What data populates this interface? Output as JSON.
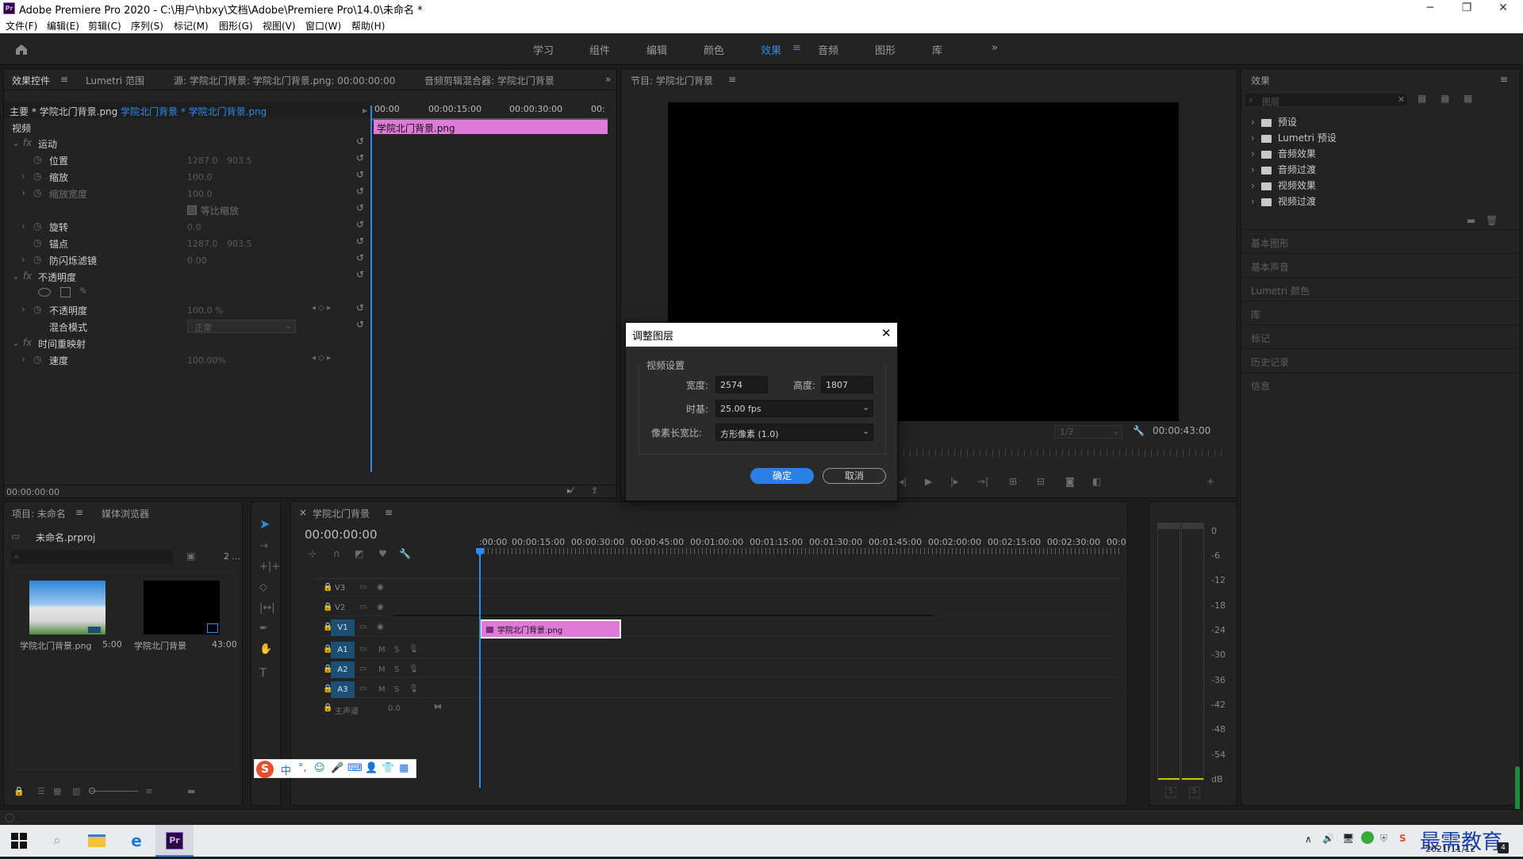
{
  "app": {
    "title": "Adobe Premiere Pro 2020 - C:\\用户\\hbxy\\文档\\Adobe\\Premiere Pro\\14.0\\未命名 *",
    "logo": "Pr",
    "window_controls": [
      "─",
      "❐",
      "✕"
    ]
  },
  "menu": [
    "文件(F)",
    "编辑(E)",
    "剪辑(C)",
    "序列(S)",
    "标记(M)",
    "图形(G)",
    "视图(V)",
    "窗口(W)",
    "帮助(H)"
  ],
  "workspaces": {
    "items": [
      "学习",
      "组件",
      "编辑",
      "颜色",
      "效果",
      "音频",
      "图形",
      "库"
    ],
    "active": "效果",
    "more": "»"
  },
  "effect_controls": {
    "tabs": [
      "效果控件",
      "Lumetri 范围",
      "源: 学院北门背景: 学院北门背景.png: 00:00:00:00",
      "音频剪辑混合器: 学院北门背景"
    ],
    "tab_menu": "≡",
    "master": "主要 * 学院北门背景.png",
    "sequence": "学院北门背景 * 学院北门背景.png",
    "ruler": [
      "00:00",
      "00:00:15:00",
      "00:00:30:00",
      "00:"
    ],
    "clip_name": "学院北门背景.png",
    "category_video": "视频",
    "motion": "运动",
    "props": [
      {
        "label": "位置",
        "v1": "1287.0",
        "v2": "903.5"
      },
      {
        "label": "缩放",
        "v1": "100.0",
        "v2": ""
      },
      {
        "label": "缩放宽度",
        "v1": "100.0",
        "v2": ""
      },
      {
        "label": "旋转",
        "v1": "0.0",
        "v2": ""
      },
      {
        "label": "锚点",
        "v1": "1287.0",
        "v2": "903.5"
      },
      {
        "label": "防闪烁滤镜",
        "v1": "0.00",
        "v2": ""
      }
    ],
    "uniform_scale": "等比缩放",
    "opacity_section": "不透明度",
    "opacity_label": "不透明度",
    "opacity_value": "100.0 %",
    "blend_label": "混合模式",
    "blend_value": "正常",
    "time_remap": "时间重映射",
    "speed_label": "速度",
    "speed_value": "100.00%",
    "timecode": "00:00:00:00"
  },
  "program": {
    "tab": "节目: 学院北门背景",
    "fit": "1/2",
    "timecode_end": "00:00:43:00"
  },
  "effects_panel": {
    "tab": "效果",
    "search_placeholder": "图层",
    "tree": [
      "预设",
      "Lumetri 预设",
      "音频效果",
      "音频过渡",
      "视频效果",
      "视频过渡"
    ],
    "sections": [
      "基本图形",
      "基本声音",
      "Lumetri 颜色",
      "库",
      "标记",
      "历史记录",
      "信息"
    ]
  },
  "project": {
    "tabs": [
      "项目: 未命名",
      "媒体浏览器"
    ],
    "file": "未命名.prproj",
    "count": "2 ...",
    "items": [
      {
        "name": "学院北门背景.png",
        "duration": "5:00"
      },
      {
        "name": "学院北门背景",
        "duration": "43:00"
      }
    ]
  },
  "timeline": {
    "tab": "学院北门背景",
    "timecode": "00:00:00:00",
    "ruler": [
      ":00:00",
      "00:00:15:00",
      "00:00:30:00",
      "00:00:45:00",
      "00:01:00:00",
      "00:01:15:00",
      "00:01:30:00",
      "00:01:45:00",
      "00:02:00:00",
      "00:02:15:00",
      "00:02:30:00",
      "00:0"
    ],
    "video_tracks": [
      "V3",
      "V2",
      "V1"
    ],
    "audio_tracks": [
      "A1",
      "A2",
      "A3"
    ],
    "master": "主声道",
    "master_value": "0.0",
    "clip": "学院北门背景.png",
    "track_m": "M",
    "track_s": "S"
  },
  "meter": {
    "scale": [
      "0",
      "-6",
      "-12",
      "-18",
      "-24",
      "-30",
      "-36",
      "-42",
      "-48",
      "-54",
      "dB"
    ],
    "buttons": [
      "S",
      "S"
    ]
  },
  "dialog": {
    "title": "调整图层",
    "group": "视频设置",
    "width_label": "宽度:",
    "width": "2574",
    "height_label": "高度:",
    "height": "1807",
    "timebase_label": "时基:",
    "timebase": "25.00 fps",
    "par_label": "像素长宽比:",
    "par": "方形像素 (1.0)",
    "ok": "确定",
    "cancel": "取消"
  },
  "ime": {
    "items": [
      "中",
      "°,",
      "☺",
      "🎤",
      "⌨",
      "👤",
      "👕",
      "▦"
    ]
  },
  "taskbar": {
    "date": "2021/11/12",
    "watermark": "最需教育",
    "notify": "4"
  },
  "colors": {
    "accent": "#2d8ceb",
    "clip_pink": "#e07ad9",
    "track_blue": "#1d4f74"
  }
}
